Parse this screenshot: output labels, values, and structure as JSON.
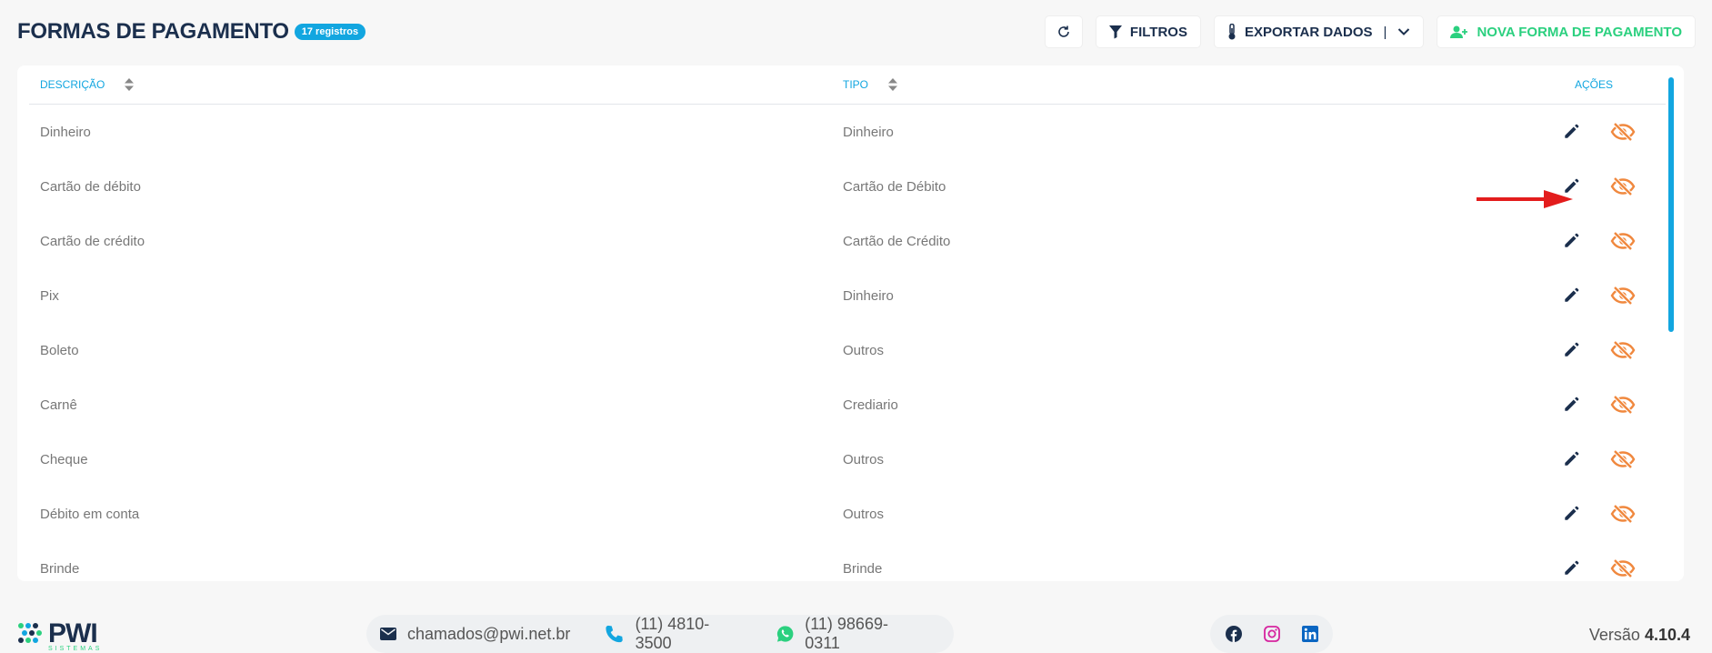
{
  "header": {
    "title": "FORMAS DE PAGAMENTO",
    "count_badge": "17 registros",
    "filters_label": "FILTROS",
    "export_label": "EXPORTAR DADOS",
    "export_separator": "|",
    "new_label": "NOVA FORMA DE PAGAMENTO"
  },
  "table": {
    "columns": {
      "description": "DESCRIÇÃO",
      "type": "TIPO",
      "actions": "AÇÕES"
    },
    "rows": [
      {
        "description": "Dinheiro",
        "type": "Dinheiro"
      },
      {
        "description": "Cartão de débito",
        "type": "Cartão de Débito"
      },
      {
        "description": "Cartão de crédito",
        "type": "Cartão de Crédito"
      },
      {
        "description": "Pix",
        "type": "Dinheiro"
      },
      {
        "description": "Boleto",
        "type": "Outros"
      },
      {
        "description": "Carnê",
        "type": "Crediario"
      },
      {
        "description": "Cheque",
        "type": "Outros"
      },
      {
        "description": "Débito em conta",
        "type": "Outros"
      },
      {
        "description": "Brinde",
        "type": "Brinde"
      }
    ]
  },
  "footer": {
    "logo_text": "PWI",
    "logo_subtext": "SISTEMAS",
    "email": "chamados@pwi.net.br",
    "phone": "(11) 4810-3500",
    "whatsapp": "(11) 98669-0311",
    "version_label": "Versão",
    "version_number": "4.10.4"
  },
  "colors": {
    "primary": "#1b2f4d",
    "accent_blue": "#12a6e0",
    "accent_green": "#2bd07f",
    "hide_icon": "#f0883e",
    "arrow": "#e31c1c"
  },
  "icons": {
    "refresh": "refresh-icon",
    "filter": "filter-icon",
    "export": "thermometer-icon",
    "dropdown": "chevron-down-icon",
    "new": "user-plus-icon",
    "sort": "sort-icon",
    "edit": "pencil-icon",
    "hide": "eye-slash-icon",
    "email": "envelope-icon",
    "phone": "phone-icon",
    "whatsapp": "whatsapp-icon",
    "facebook": "facebook-icon",
    "instagram": "instagram-icon",
    "linkedin": "linkedin-icon"
  }
}
